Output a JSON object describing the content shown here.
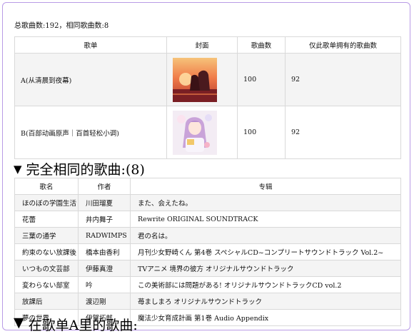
{
  "summary": "总歌曲数:192，相同歌曲数:8",
  "playlist_table": {
    "headers": [
      "歌单",
      "封面",
      "歌曲数",
      "仅此歌单拥有的歌曲数"
    ],
    "rows": [
      {
        "name": "A(从清晨到夜幕)",
        "cover_icon": "sunset-couple-cover-art",
        "count": "100",
        "unique": "92"
      },
      {
        "name": "B(百部动画原声｜百首轻松小调)",
        "cover_icon": "anime-girl-cover-art",
        "count": "100",
        "unique": "92"
      }
    ]
  },
  "same_songs_section": {
    "toggle_glyph": "▼",
    "title": "完全相同的歌曲:(8)",
    "headers": [
      "歌名",
      "作者",
      "专辑"
    ],
    "rows": [
      {
        "song": "ほのぼの学園生活",
        "artist": "川田瑠夏",
        "album": "また、会えたね。"
      },
      {
        "song": "花蕾",
        "artist": "井内舞子",
        "album": "Rewrite ORIGINAL SOUNDTRACK"
      },
      {
        "song": "三葉の通学",
        "artist": "RADWIMPS",
        "album": "君の名は。"
      },
      {
        "song": "約束のない放課後",
        "artist": "橋本由香利",
        "album": "月刊少女野崎くん 第4巻 スペシャルCD~コンプリートサウンドトラック Vol.2~"
      },
      {
        "song": "いつもの文芸部",
        "artist": "伊藤真澄",
        "album": "TVアニメ 境界の彼方 オリジナルサウンドトラック"
      },
      {
        "song": "変わらない部室",
        "artist": "吟",
        "album": "この美術部には問題がある! オリジナルサウンドトラックCD vol.2"
      },
      {
        "song": "放課后",
        "artist": "渡辺剛",
        "album": "苺ましまろ オリジナルサウンドトラック"
      },
      {
        "song": "夢の世界",
        "artist": "伊賀拓郎",
        "album": "魔法少女育成計画 第1巻 Audio Appendix"
      }
    ]
  },
  "next_section_fragment": {
    "toggle_glyph": "▼",
    "title": "在歌单A里的歌曲:"
  },
  "colors": {
    "frame_border": "#b99be6",
    "row_stripe": "#f4f4f4",
    "grid": "#d9d9d9"
  }
}
